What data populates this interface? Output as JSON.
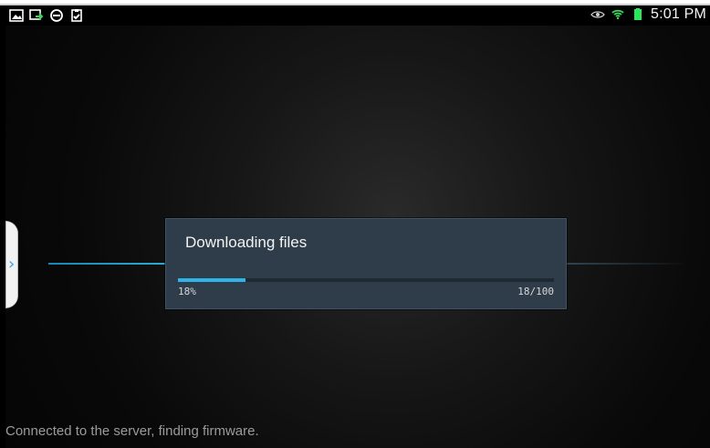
{
  "status_bar": {
    "left_icons": [
      "gallery-icon",
      "screen-mirroring-icon",
      "do-not-disturb-icon",
      "clipboard-check-icon"
    ],
    "right_icons": [
      "eye-icon",
      "wifi-icon",
      "battery-icon"
    ],
    "time": "5:01 PM"
  },
  "side_tab": {
    "icon": "chevron-right-icon",
    "accent": "#2ea7e7"
  },
  "dialog": {
    "title": "Downloading files",
    "progress_fraction": 0.18,
    "progress_percent_label": "18%",
    "progress_count_label": "18/100",
    "colors": {
      "background": "#2f3d4a",
      "progress": "#2fb4e7"
    }
  },
  "bottom_status": {
    "text": "Connected to the server, finding firmware."
  }
}
